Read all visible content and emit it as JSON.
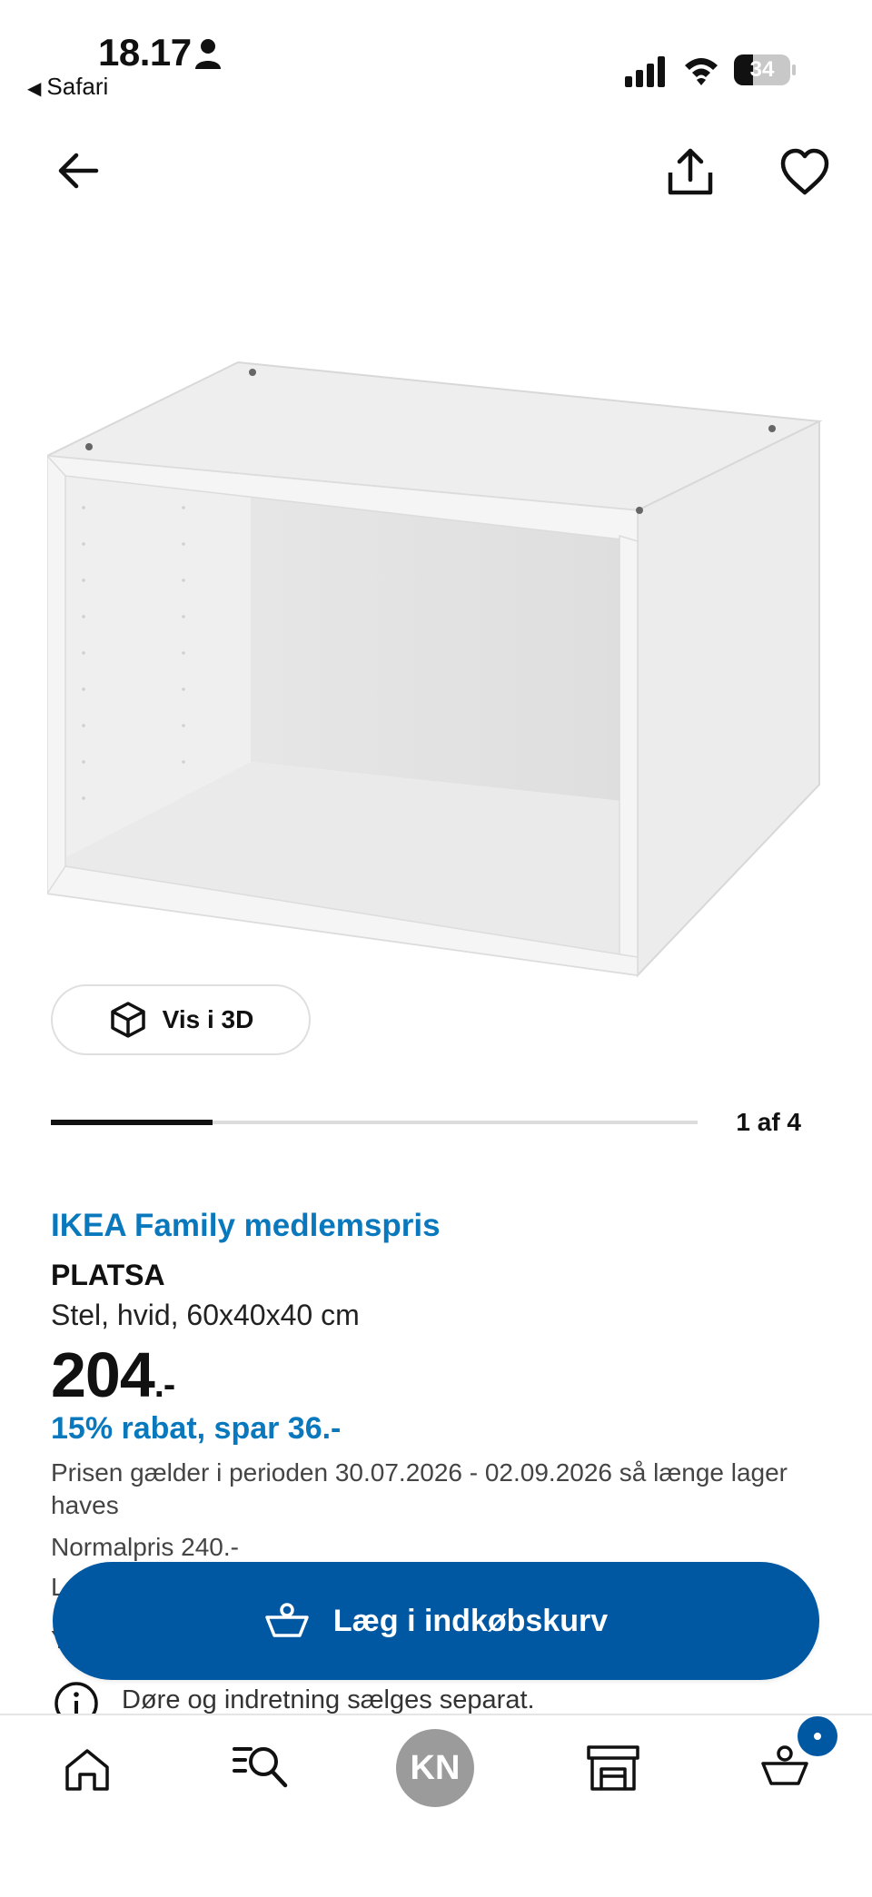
{
  "status_bar": {
    "time": "18.17",
    "back_app": "Safari",
    "battery_level": "34"
  },
  "product": {
    "family_price_label": "IKEA Family medlemspris",
    "name": "PLATSA",
    "description": "Stel, hvid, 60x40x40 cm",
    "price": "204",
    "price_suffix": ".-",
    "discount": "15% rabat, spar 36.-",
    "validity": "Prisen gælder i perioden 30.07.2026 - 02.09.2026 så længe lager haves",
    "normal_price": "Normalpris 240.-",
    "partially_hidden_1": "L",
    "partially_hidden_2": "Y",
    "info_note": "Døre og indretning sælges separat."
  },
  "gallery": {
    "view_3d_label": "Vis i 3D",
    "counter": "1 af 4",
    "current_index": 1,
    "total": 4
  },
  "actions": {
    "add_to_cart": "Læg i indkøbskurv"
  },
  "tabbar": {
    "avatar_initials": "KN",
    "cart_badge": "•"
  },
  "colors": {
    "ikea_blue": "#0058a3",
    "family_blue": "#0a78bd",
    "avatar_gray": "#9b9b9b"
  },
  "icons": [
    "arrow-left-icon",
    "share-icon",
    "heart-icon",
    "cube-3d-icon",
    "basket-icon",
    "info-icon",
    "home-icon",
    "search-list-icon",
    "store-icon",
    "cart-icon"
  ]
}
